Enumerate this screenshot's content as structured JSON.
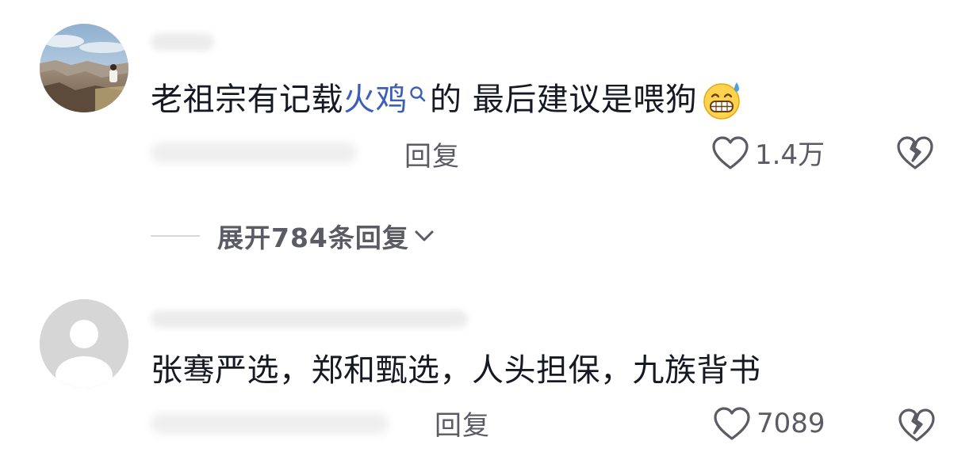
{
  "comments": [
    {
      "text_part1": "老祖宗有记载",
      "keyword": "火鸡",
      "text_part2": "的 最后建议是喂狗",
      "reply_label": "回复",
      "like_count": "1.4万"
    },
    {
      "text": "张骞严选，郑和甄选，人头担保，九族背书",
      "reply_label": "回复",
      "like_count": "7089"
    }
  ],
  "expand_replies": {
    "label": "展开784条回复"
  },
  "icons": {
    "search": "search-icon",
    "emoji": "grinning-sweat-emoji",
    "like": "heart-icon",
    "dislike": "broken-heart-icon",
    "expand": "chevron-down-icon"
  },
  "colors": {
    "text": "#161823",
    "secondary": "#5b5b66",
    "keyword_link": "#3d5fb8"
  }
}
